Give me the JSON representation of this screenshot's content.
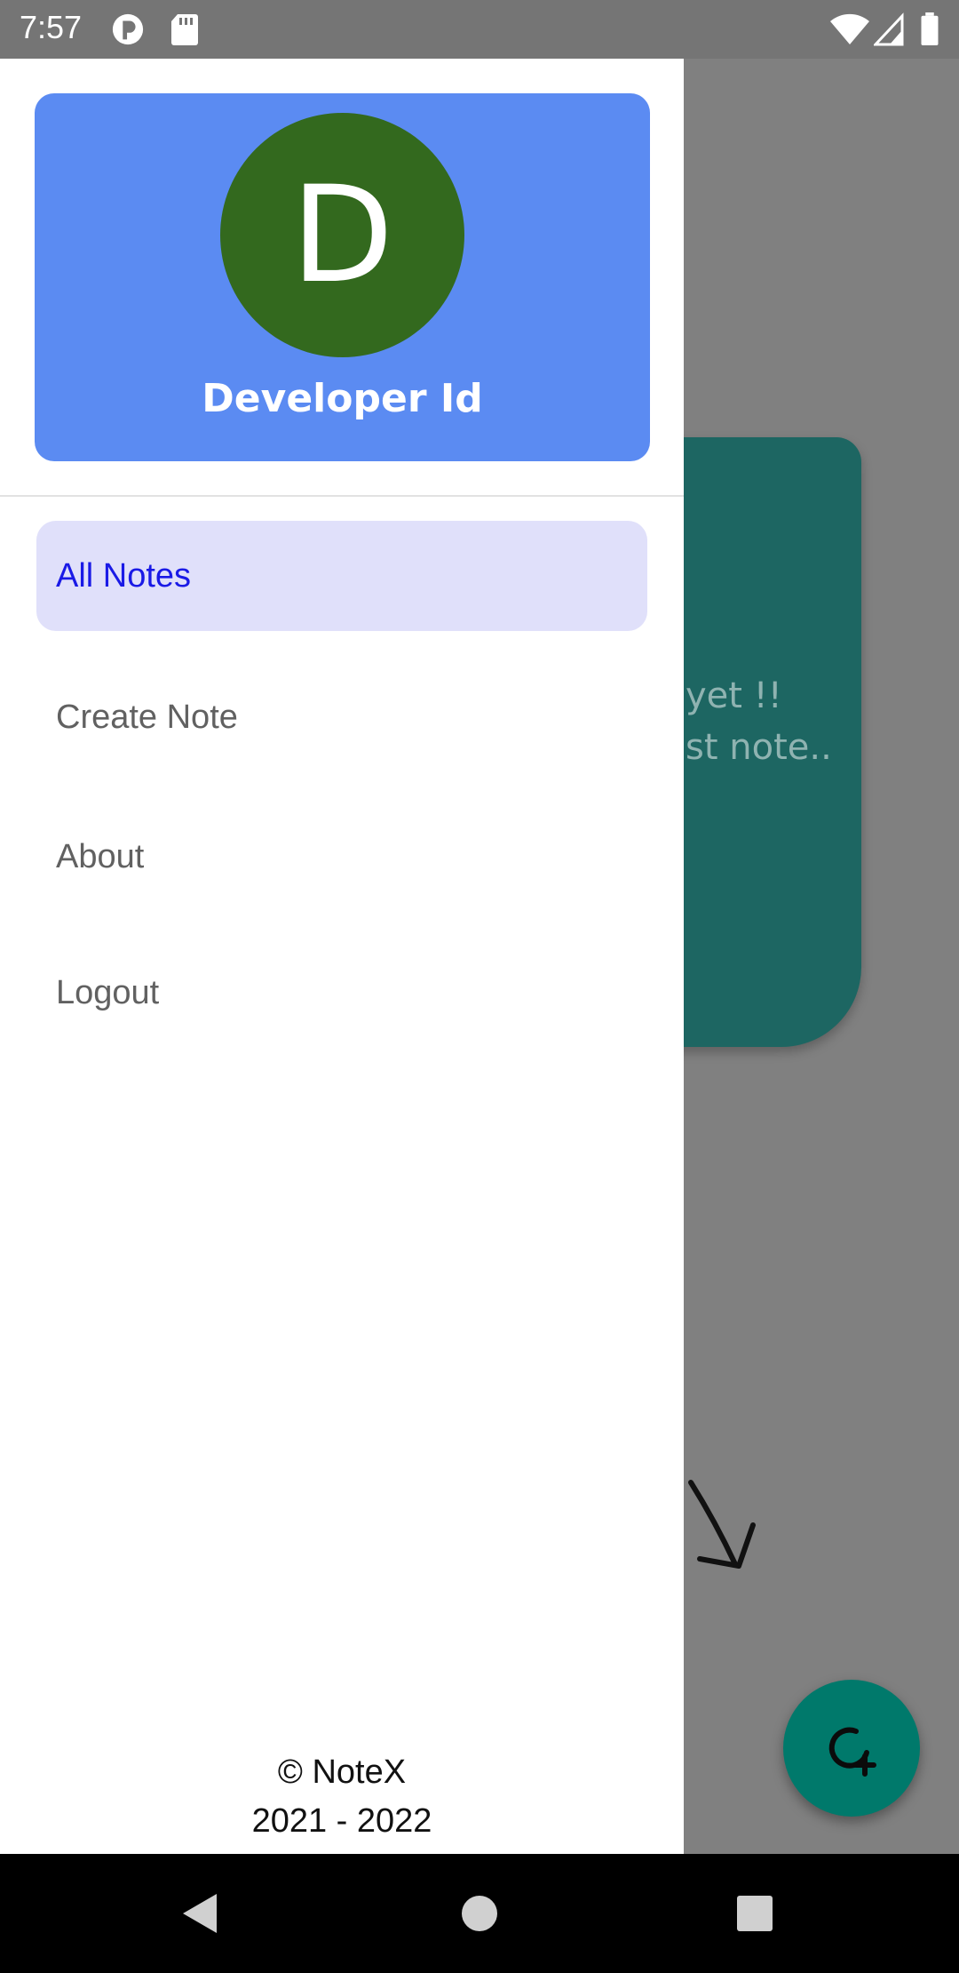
{
  "status_bar": {
    "time": "7:57",
    "icons": [
      "notification-app-icon",
      "sd-card-icon",
      "wifi-icon",
      "cell-signal-icon",
      "battery-icon"
    ]
  },
  "background_screen": {
    "empty_text_line1": "yet !!",
    "empty_text_line2": "st note..",
    "card_color": "#1d6662",
    "fab_icon": "add-note-icon"
  },
  "drawer": {
    "profile": {
      "avatar_letter": "D",
      "name": "Developer Id",
      "card_color": "#5b8bf2",
      "avatar_color": "#33691e"
    },
    "menu": [
      {
        "label": "All Notes",
        "active": true
      },
      {
        "label": "Create Note",
        "active": false
      },
      {
        "label": "About",
        "active": false
      },
      {
        "label": "Logout",
        "active": false
      }
    ],
    "footer": {
      "copyright": "© NoteX",
      "years": "2021 - 2022"
    }
  },
  "nav_bar": {
    "buttons": [
      "back-icon",
      "home-icon",
      "recents-icon"
    ]
  }
}
